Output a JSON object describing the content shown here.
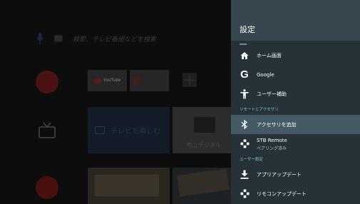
{
  "home": {
    "search_hint": "検索、テレビ番組などを検索",
    "tiles": {
      "youtube_label": "YouTube",
      "tv_tile_label": "テレビを楽しむ",
      "digital_tile_label": "地上デジタル",
      "add_symbol": "+"
    }
  },
  "settings": {
    "title": "設定",
    "items_top": [
      {
        "label": "ホーム画面",
        "icon": "home-icon"
      },
      {
        "label": "Google",
        "icon": "google-icon"
      },
      {
        "label": "ユーザー補助",
        "icon": "accessibility-icon"
      }
    ],
    "section_remote": "リモートとアクセサリ",
    "add_accessory": {
      "label": "アクセサリを追加",
      "icon": "bluetooth-icon"
    },
    "stb_remote": {
      "label": "STB Remote",
      "sub": "ペアリング済み",
      "icon": "gamepad-icon"
    },
    "section_user": "ユーザー設定",
    "items_user": [
      {
        "label": "アプリアップデート",
        "icon": "download-icon"
      },
      {
        "label": "リモコンアップデート",
        "icon": "gamepad-icon"
      }
    ]
  },
  "colors": {
    "panel_bg": "#263238",
    "panel_header": "#37474f",
    "selected_row": "#455a64",
    "section_text": "#80cbc4"
  }
}
